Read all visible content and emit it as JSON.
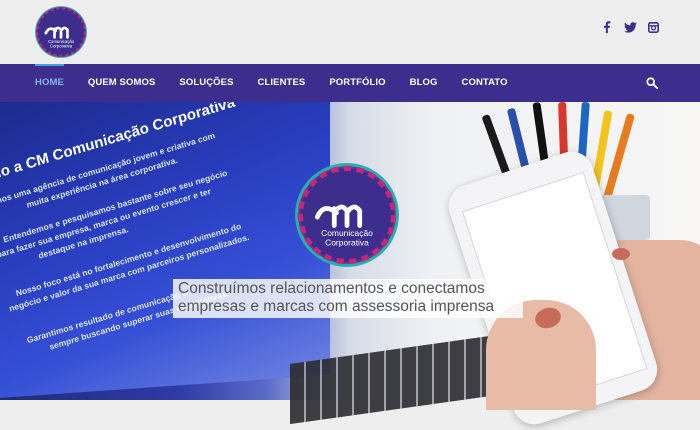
{
  "brand": {
    "logo_text": "CM",
    "logo_sub1": "Comunicação",
    "logo_sub2": "Corporativa",
    "purple": "#3d2d8c",
    "teal": "#21b3b0"
  },
  "social": {
    "icons": [
      "facebook-icon",
      "twitter-icon",
      "instagram-icon"
    ]
  },
  "nav": {
    "items": [
      {
        "label": "HOME",
        "active": true
      },
      {
        "label": "QUEM SOMOS"
      },
      {
        "label": "SOLUÇÕES"
      },
      {
        "label": "CLIENTES"
      },
      {
        "label": "PORTFÓLIO"
      },
      {
        "label": "BLOG"
      },
      {
        "label": "CONTATO"
      }
    ],
    "search_icon": "search-icon"
  },
  "hero": {
    "screen_title": "vindo a CM Comunicação Corporativa",
    "screen_lines": [
      "mos uma agência de comunicação jovem e criativa com",
      "muita experiência na área corporativa.",
      "Entendemos e pesquisamos bastante sobre seu negócio",
      "para fazer sua empresa, marca ou evento crescer e ter",
      "destaque na imprensa.",
      "Nosso foco está no fortalecimento e desenvolvimento do",
      "negócio e valor da sua marca com parceiros personalizados.",
      "Garantimos resultado de comunicação e",
      "sempre buscando superar suas expectativas."
    ],
    "tagline_line1": "Construímos relacionamentos e conectamos",
    "tagline_line2": "empresas e marcas com assessoria imprensa"
  }
}
